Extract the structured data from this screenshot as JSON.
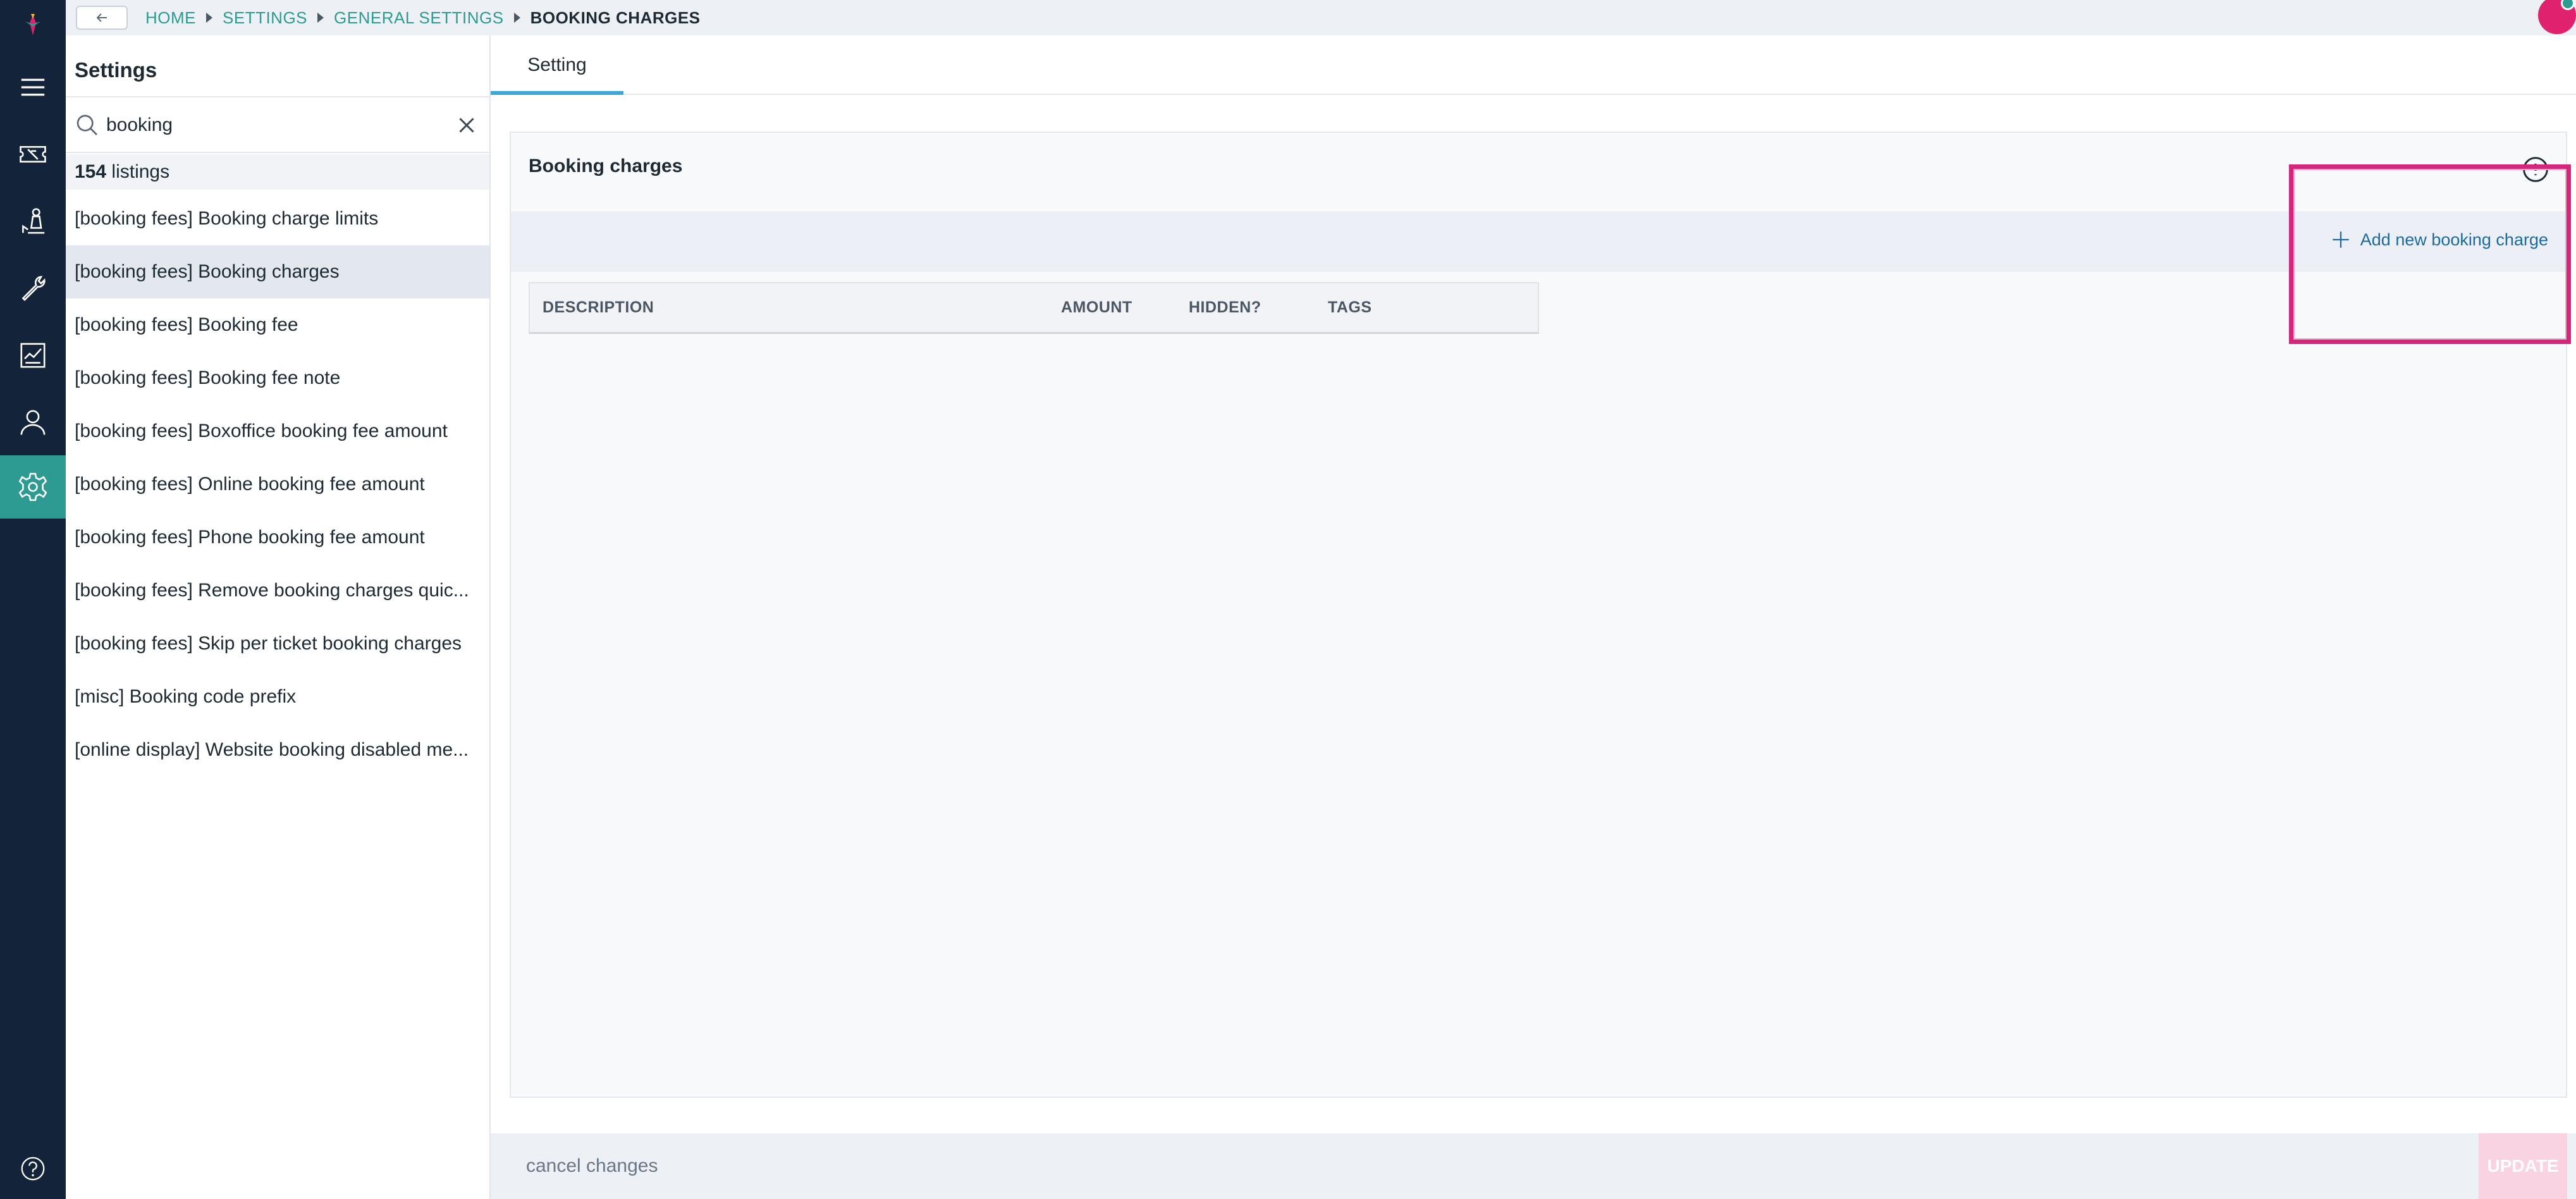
{
  "header": {
    "breadcrumb": [
      {
        "label": "HOME"
      },
      {
        "label": "SETTINGS"
      },
      {
        "label": "GENERAL SETTINGS"
      },
      {
        "label": "BOOKING CHARGES"
      }
    ]
  },
  "rail": {
    "items": [
      {
        "icon": "logo-icon"
      },
      {
        "icon": "menu-icon"
      },
      {
        "icon": "ticket-icon"
      },
      {
        "icon": "chess-piece-icon"
      },
      {
        "icon": "wrench-icon"
      },
      {
        "icon": "report-icon"
      },
      {
        "icon": "user-icon"
      },
      {
        "icon": "gear-icon",
        "active": true
      },
      {
        "icon": "help-icon"
      }
    ],
    "colors": {
      "background": "#13243a",
      "active": "#2d9b92"
    }
  },
  "settings_panel": {
    "title": "Settings",
    "search": {
      "value": "booking"
    },
    "listing_count": "154",
    "listing_label": "listings",
    "items": [
      {
        "label": "[booking fees] Booking charge limits"
      },
      {
        "label": "[booking fees] Booking charges",
        "selected": true
      },
      {
        "label": "[booking fees] Booking fee"
      },
      {
        "label": "[booking fees] Booking fee note"
      },
      {
        "label": "[booking fees] Boxoffice booking fee amount"
      },
      {
        "label": "[booking fees] Online booking fee amount"
      },
      {
        "label": "[booking fees] Phone booking fee amount"
      },
      {
        "label": "[booking fees] Remove booking charges quic..."
      },
      {
        "label": "[booking fees] Skip per ticket booking charges"
      },
      {
        "label": "[misc] Booking code prefix"
      },
      {
        "label": "[online display] Website booking disabled me..."
      }
    ]
  },
  "main": {
    "tabs": [
      {
        "label": "Setting",
        "active": true
      }
    ],
    "card": {
      "title": "Booking charges",
      "add_button": "Add new booking charge",
      "table": {
        "columns": [
          "DESCRIPTION",
          "AMOUNT",
          "HIDDEN?",
          "TAGS"
        ]
      }
    },
    "footer": {
      "cancel": "cancel changes",
      "update": "UPDATE"
    }
  },
  "colors": {
    "accent": "#2d9b92",
    "link": "#1c6b9c",
    "highlight": "#d4267a",
    "update_disabled": "#f9d3e2"
  }
}
